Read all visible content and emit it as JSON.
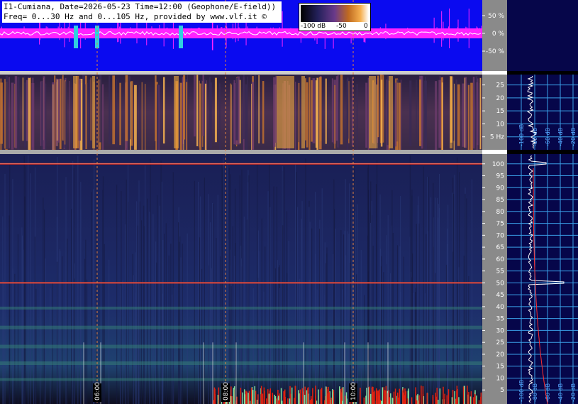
{
  "header": {
    "line1": "I1-Cumiana, Date=2026-05-23 Time=12:00 (Geophone/E-field))",
    "line2": "Freq= 0...30 Hz and 0...105 Hz, provided by www.vlf.it ©"
  },
  "colorbar": {
    "labels": [
      "-100 dB",
      "-50",
      "0"
    ],
    "colors": [
      "#000000",
      "#2a2a7a",
      "#5a3a9a",
      "#c06a20",
      "#f0a840",
      "#ffffff"
    ]
  },
  "chart_data": [
    {
      "type": "line",
      "name": "amplitude",
      "ylabel_ticks": [
        "50 %",
        "0 %",
        "-50 %"
      ],
      "ylim": [
        -70,
        70
      ]
    },
    {
      "type": "heatmap",
      "name": "spectrogram-0-30hz",
      "y_ticks": [
        25,
        20,
        15,
        10,
        5
      ],
      "y_unit": "Hz",
      "ylim": [
        0,
        29
      ]
    },
    {
      "type": "heatmap",
      "name": "spectrogram-0-105hz",
      "y_ticks": [
        100,
        95,
        90,
        85,
        80,
        75,
        70,
        65,
        60,
        55,
        50,
        45,
        40,
        35,
        30,
        25,
        20,
        15,
        10,
        5
      ],
      "ylim": [
        0,
        105
      ],
      "time_markers": [
        "06:00",
        "08:00",
        "10:00"
      ]
    },
    {
      "type": "line",
      "name": "spectrum-side-panels",
      "db_ticks_top": [
        "-100 dB",
        "-80 dB",
        "-60 dB",
        "-40 dB",
        "-20 dB"
      ],
      "db_ticks_bottom": [
        "-100 dB",
        "-80 dB",
        "-60 dB",
        "-40 dB",
        "-20 dB"
      ]
    }
  ],
  "colors": {
    "amp_bg": "#0a0af0",
    "amp_trace": "#ff22ff",
    "spec_bg": "#161a4a",
    "axis_bg": "#8a8a8a",
    "side_bg": "#06064a",
    "grid": "#3aa0e8",
    "hum": "#e03020",
    "mark": "#e08040"
  }
}
